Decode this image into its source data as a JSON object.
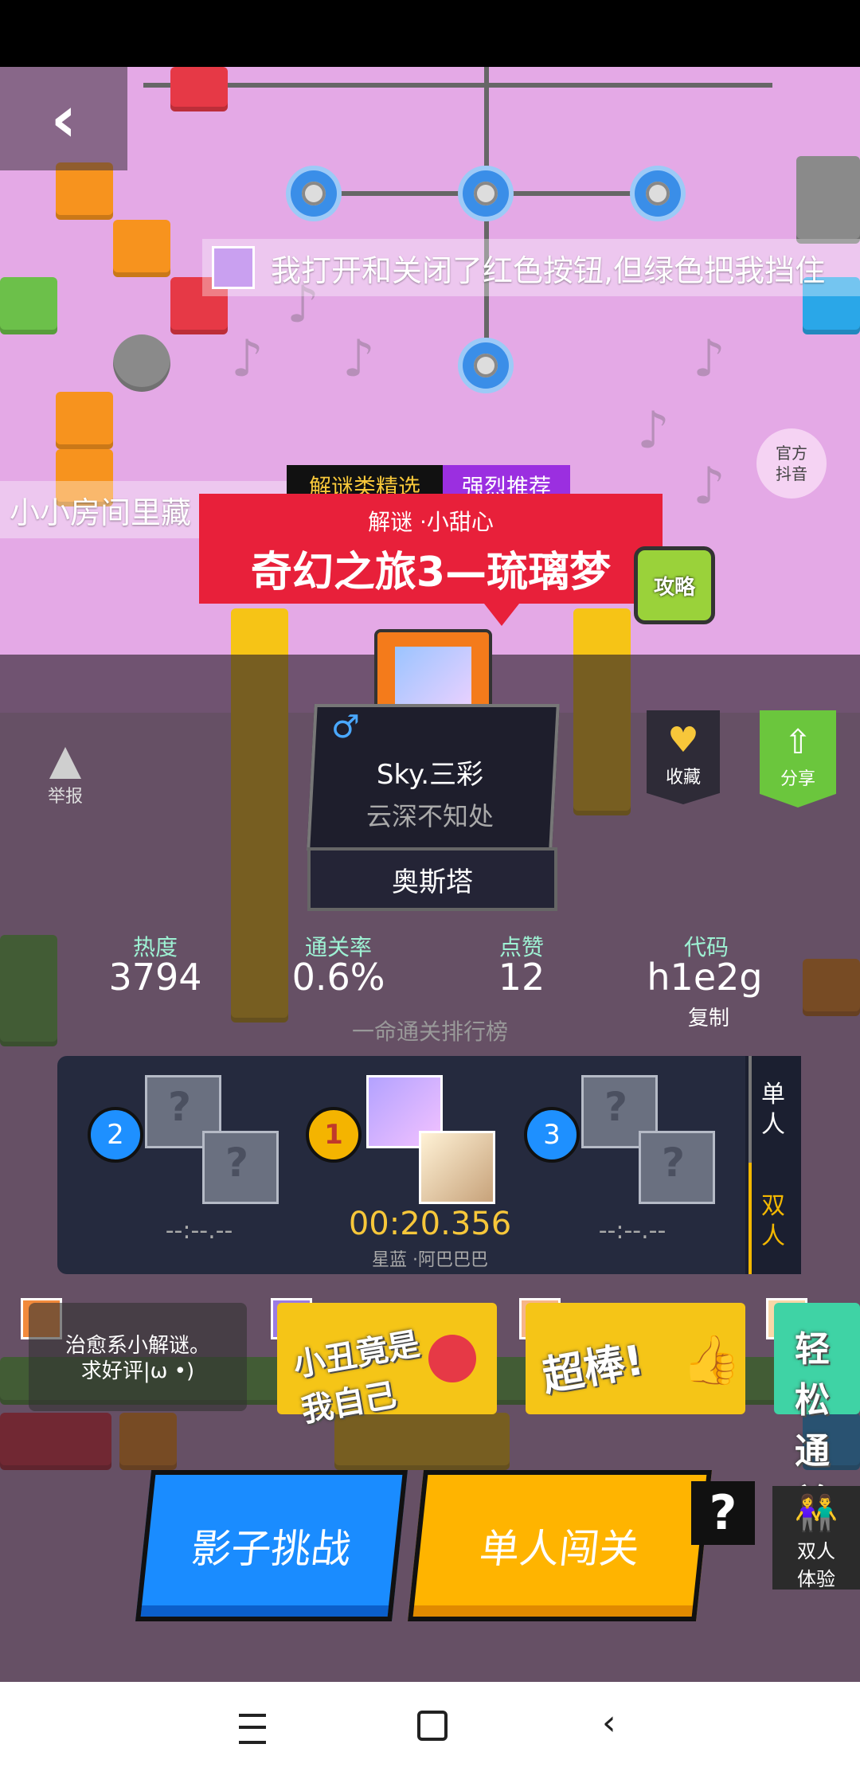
{
  "nav": {
    "back_icon": "chevron-left"
  },
  "scene_chat": [
    {
      "text": "我打开和关闭了红色按钮,但绿色把我挡住"
    },
    {
      "text": "小小房间里藏"
    }
  ],
  "official_badge": {
    "line1": "官方",
    "line2": "抖音"
  },
  "tags": {
    "category": "解谜类精选",
    "recommend": "强烈推荐"
  },
  "level": {
    "subtitle": "解谜 ·小甜心",
    "title": "奇幻之旅3—琉璃梦",
    "guide_label": "攻略"
  },
  "actions": {
    "report": "举报",
    "favorite": "收藏",
    "share": "分享"
  },
  "author": {
    "gender_symbol": "♂",
    "name": "Sky.三彩",
    "motto": "云深不知处",
    "stage": "奥斯塔"
  },
  "stats": [
    {
      "label": "热度",
      "value": "3794"
    },
    {
      "label": "通关率",
      "value": "0.6%"
    },
    {
      "label": "点赞",
      "value": "12"
    },
    {
      "label": "代码",
      "value": "h1e2g"
    }
  ],
  "copy_label": "复制",
  "leaderboard": {
    "title": "一命通关排行榜",
    "tab_single": [
      "单",
      "人"
    ],
    "tab_double": [
      "双",
      "人"
    ],
    "selected_tab": "双人",
    "entries": [
      {
        "rank": "2",
        "time": "--:--.--",
        "players": ""
      },
      {
        "rank": "1",
        "time": "00:20.356",
        "players": "星蓝 ·阿巴巴巴"
      },
      {
        "rank": "3",
        "time": "--:--.--",
        "players": ""
      }
    ]
  },
  "comments": [
    {
      "text_line1": "治愈系小解谜。",
      "text_line2": "求好评|ω •)"
    },
    {
      "line1": "小丑竟是",
      "line2": "我自己"
    },
    {
      "text": "超棒!"
    },
    {
      "line1": "轻松",
      "line2": "通关"
    }
  ],
  "buttons": {
    "shadow_challenge": "影子挑战",
    "solo_run": "单人闯关",
    "help": "?",
    "duo_line1": "双人",
    "duo_line2": "体验"
  },
  "colors": {
    "banner_red": "#e8203a",
    "tag_purple": "#9b2fe0",
    "shadow_blue": "#1a8cff",
    "solo_orange": "#ffb400",
    "share_green": "#6bc63d",
    "stat_label": "#9ef2d4"
  }
}
